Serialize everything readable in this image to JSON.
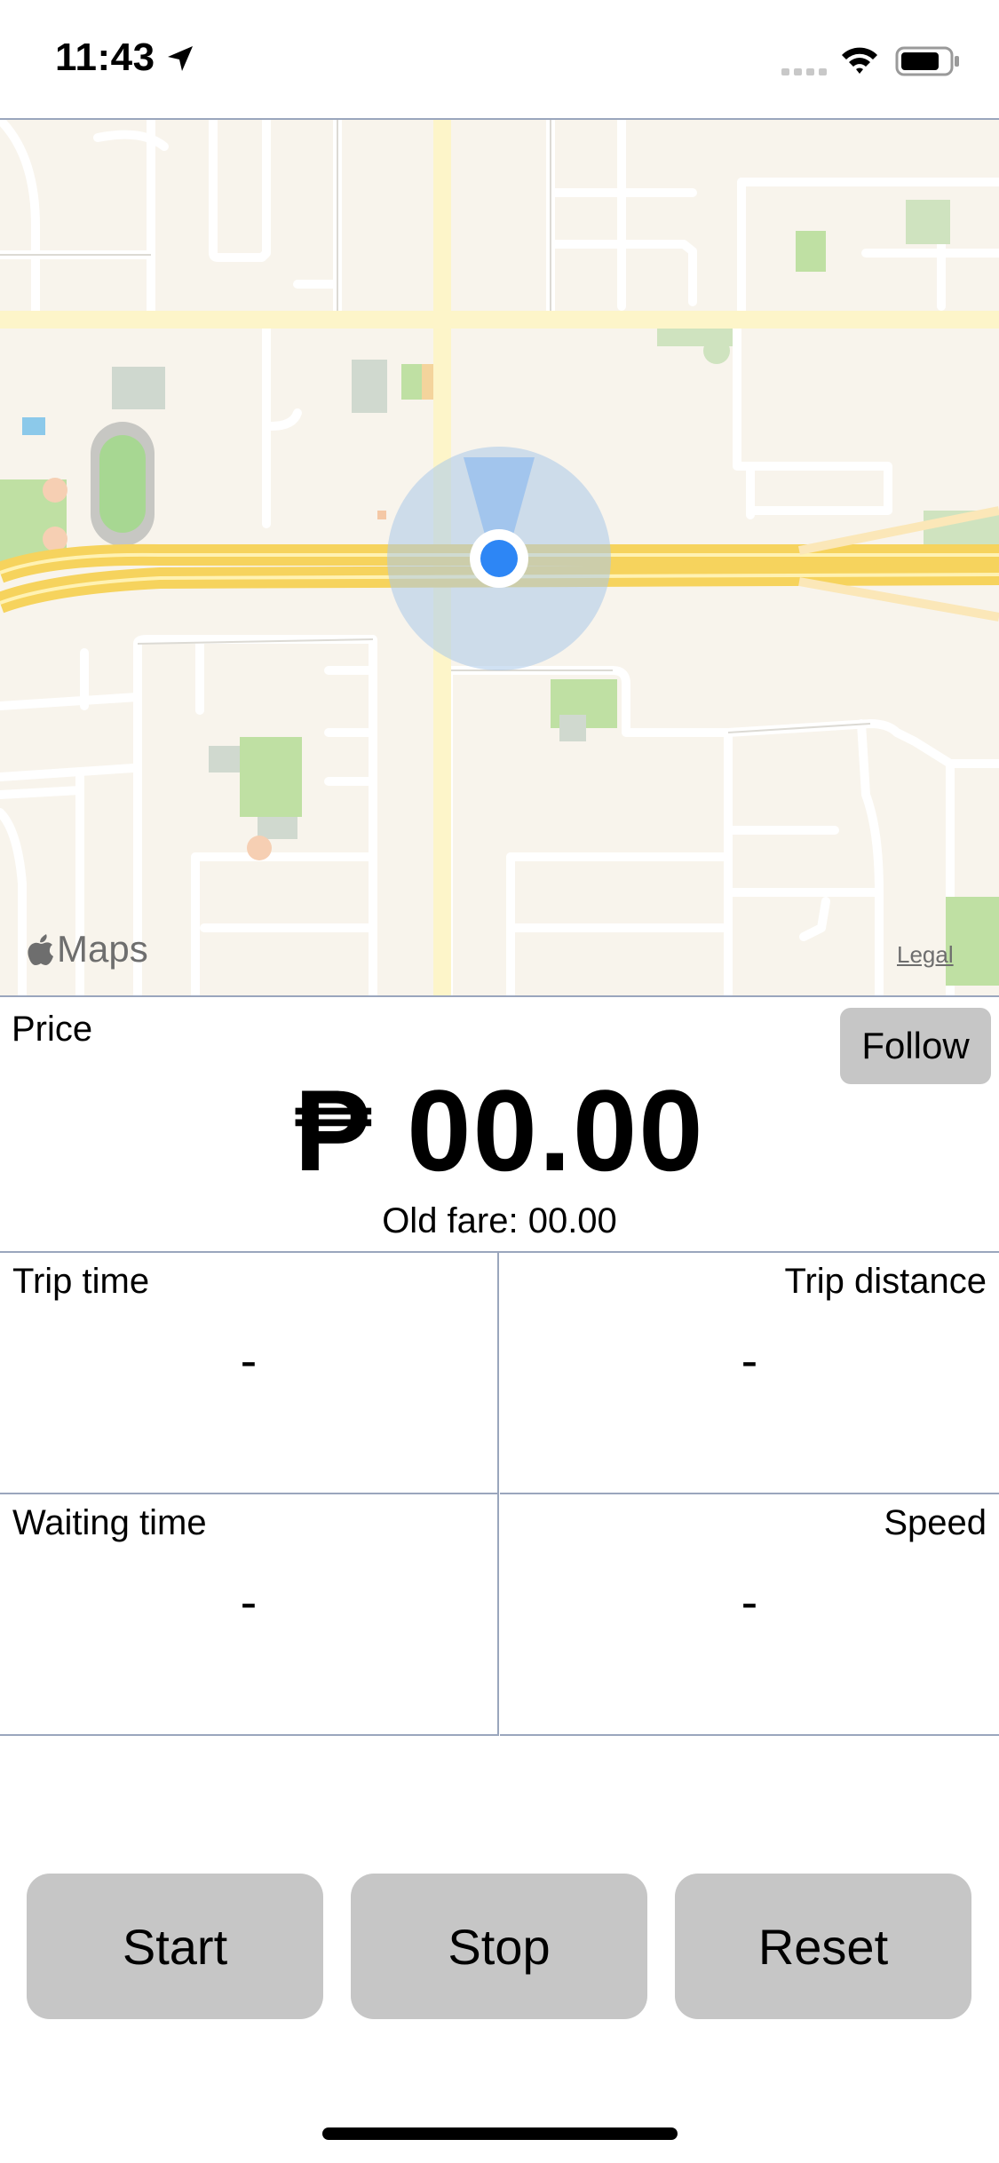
{
  "status_bar": {
    "time": "11:43",
    "location_icon": "location-arrow-icon",
    "signal_icon": "signal-icon",
    "wifi_icon": "wifi-icon",
    "battery_icon": "battery-icon"
  },
  "map": {
    "logo_text": "Maps",
    "legal_label": "Legal",
    "colors": {
      "land": "#f8f4ec",
      "highway": "#f7d96b",
      "street": "#ffffff",
      "park": "#bfe0a3",
      "location": "#2d86f5"
    }
  },
  "price": {
    "label": "Price",
    "value": "₱ 00.00",
    "old_fare": "Old fare: 00.00",
    "follow_label": "Follow"
  },
  "stats": {
    "trip_time": {
      "label": "Trip time",
      "value": "-"
    },
    "trip_distance": {
      "label": "Trip distance",
      "value": "-"
    },
    "waiting_time": {
      "label": "Waiting time",
      "value": "-"
    },
    "speed": {
      "label": "Speed",
      "value": "-"
    }
  },
  "buttons": {
    "start": "Start",
    "stop": "Stop",
    "reset": "Reset"
  }
}
